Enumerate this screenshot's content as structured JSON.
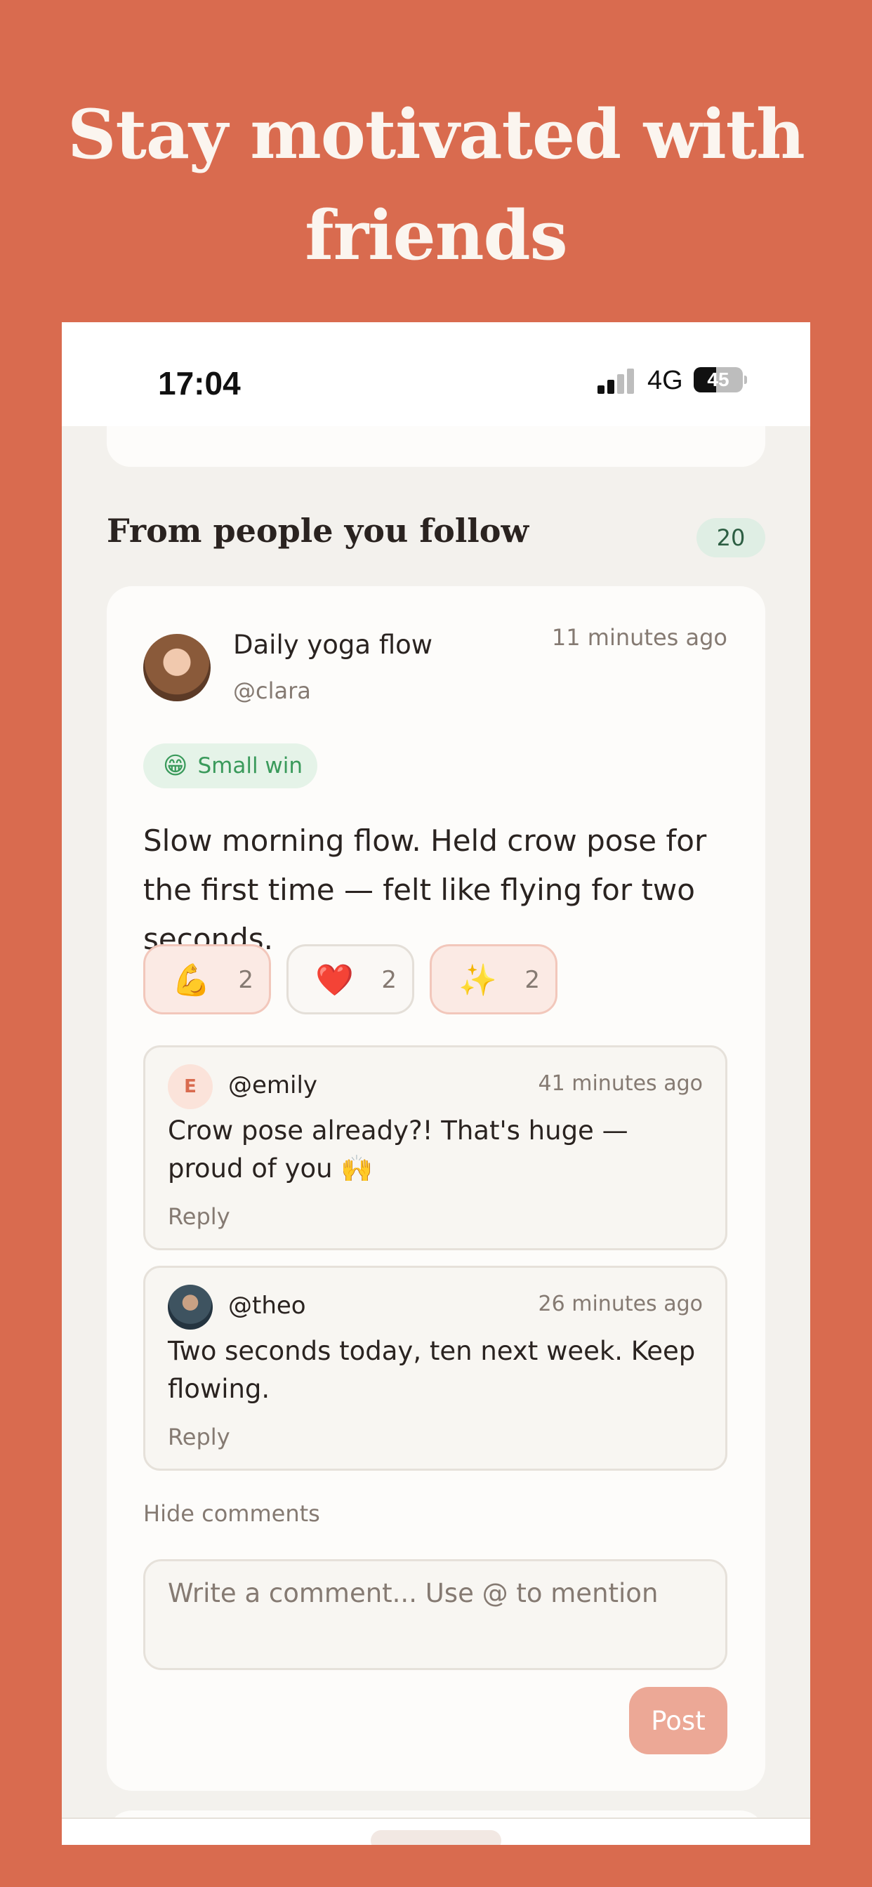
{
  "headline": "Stay motivated with friends",
  "status_bar": {
    "time": "17:04",
    "network": "4G",
    "battery": "45",
    "battery_level": 0.45
  },
  "section": {
    "title": "From people you follow",
    "count": "20"
  },
  "post": {
    "title": "Daily yoga flow",
    "handle": "@clara",
    "time": "11 minutes ago",
    "badge": {
      "emoji": "😁",
      "label": "Small win"
    },
    "body": "Slow morning flow. Held crow pose for the first time — felt like flying for two seconds.",
    "reactions": [
      {
        "emoji": "💪",
        "count": "2"
      },
      {
        "emoji": "❤️",
        "count": "2"
      },
      {
        "emoji": "✨",
        "count": "2"
      }
    ],
    "comments": [
      {
        "initial": "E",
        "handle": "@emily",
        "time": "41 minutes ago",
        "text": "Crow pose already?! That's huge — proud of you 🙌",
        "reply": "Reply"
      },
      {
        "initial": "",
        "handle": "@theo",
        "time": "26 minutes ago",
        "text": "Two seconds today, ten next week. Keep flowing.",
        "reply": "Reply"
      }
    ],
    "hide_comments": "Hide comments",
    "comment_placeholder": "Write a comment... Use @ to mention",
    "post_button": "Post"
  }
}
